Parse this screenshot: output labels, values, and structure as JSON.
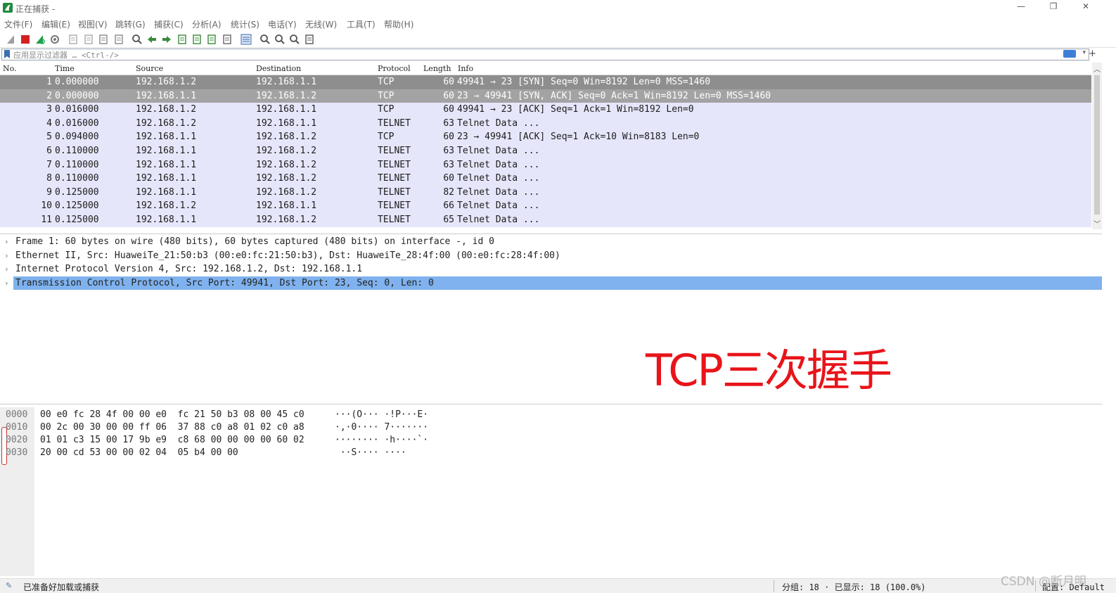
{
  "window": {
    "title": "正在捕获 -",
    "controls": {
      "minimize": "—",
      "restore": "❐",
      "close": "✕"
    }
  },
  "menu": [
    "文件(F)",
    "编辑(E)",
    "视图(V)",
    "跳转(G)",
    "捕获(C)",
    "分析(A)",
    "统计(S)",
    "电话(Y)",
    "无线(W)",
    "工具(T)",
    "帮助(H)"
  ],
  "toolbar": {
    "icons": [
      "shark-fin-start-icon",
      "stop-icon",
      "restart-icon",
      "options-gear-icon",
      "open-file-icon",
      "save-icon",
      "close-file-icon",
      "reload-icon",
      "find-icon",
      "back-arrow-icon",
      "forward-arrow-icon",
      "goto-packet-icon",
      "first-packet-icon",
      "last-packet-icon",
      "autoscroll-icon",
      "colorize-icon",
      "zoom-in-icon",
      "zoom-out-icon",
      "zoom-normal-icon",
      "resize-columns-icon"
    ]
  },
  "filter": {
    "placeholder": "应用显示过滤器 … <Ctrl-/>",
    "add_label": "+"
  },
  "packet_list": {
    "columns": [
      "No.",
      "Time",
      "Source",
      "Destination",
      "Protocol",
      "Length",
      "Info"
    ],
    "rows": [
      {
        "no": "1",
        "time": "0.000000",
        "src": "192.168.1.2",
        "dst": "192.168.1.1",
        "proto": "TCP",
        "len": "60",
        "info": "49941 → 23 [SYN] Seq=0 Win=8192 Len=0 MSS=1460",
        "bg": "#8e8e8e",
        "fg": "#ffffff"
      },
      {
        "no": "2",
        "time": "0.000000",
        "src": "192.168.1.1",
        "dst": "192.168.1.2",
        "proto": "TCP",
        "len": "60",
        "info": "23 → 49941 [SYN, ACK] Seq=0 Ack=1 Win=8192 Len=0 MSS=1460",
        "bg": "#a3a3a3",
        "fg": "#ffffff"
      },
      {
        "no": "3",
        "time": "0.016000",
        "src": "192.168.1.2",
        "dst": "192.168.1.1",
        "proto": "TCP",
        "len": "60",
        "info": "49941 → 23 [ACK] Seq=1 Ack=1 Win=8192 Len=0",
        "bg": "#e6e6fb",
        "fg": "#1c1c1c"
      },
      {
        "no": "4",
        "time": "0.016000",
        "src": "192.168.1.2",
        "dst": "192.168.1.1",
        "proto": "TELNET",
        "len": "63",
        "info": "Telnet Data ...",
        "bg": "#e6e6fb",
        "fg": "#1c1c1c"
      },
      {
        "no": "5",
        "time": "0.094000",
        "src": "192.168.1.1",
        "dst": "192.168.1.2",
        "proto": "TCP",
        "len": "60",
        "info": "23 → 49941 [ACK] Seq=1 Ack=10 Win=8183 Len=0",
        "bg": "#e6e6fb",
        "fg": "#1c1c1c"
      },
      {
        "no": "6",
        "time": "0.110000",
        "src": "192.168.1.1",
        "dst": "192.168.1.2",
        "proto": "TELNET",
        "len": "63",
        "info": "Telnet Data ...",
        "bg": "#e6e6fb",
        "fg": "#1c1c1c"
      },
      {
        "no": "7",
        "time": "0.110000",
        "src": "192.168.1.1",
        "dst": "192.168.1.2",
        "proto": "TELNET",
        "len": "63",
        "info": "Telnet Data ...",
        "bg": "#e6e6fb",
        "fg": "#1c1c1c"
      },
      {
        "no": "8",
        "time": "0.110000",
        "src": "192.168.1.1",
        "dst": "192.168.1.2",
        "proto": "TELNET",
        "len": "60",
        "info": "Telnet Data ...",
        "bg": "#e6e6fb",
        "fg": "#1c1c1c"
      },
      {
        "no": "9",
        "time": "0.125000",
        "src": "192.168.1.1",
        "dst": "192.168.1.2",
        "proto": "TELNET",
        "len": "82",
        "info": "Telnet Data ...",
        "bg": "#e6e6fb",
        "fg": "#1c1c1c"
      },
      {
        "no": "10",
        "time": "0.125000",
        "src": "192.168.1.2",
        "dst": "192.168.1.1",
        "proto": "TELNET",
        "len": "66",
        "info": "Telnet Data ...",
        "bg": "#e6e6fb",
        "fg": "#1c1c1c"
      },
      {
        "no": "11",
        "time": "0.125000",
        "src": "192.168.1.1",
        "dst": "192.168.1.2",
        "proto": "TELNET",
        "len": "65",
        "info": "Telnet Data ...",
        "bg": "#e6e6fb",
        "fg": "#1c1c1c"
      }
    ]
  },
  "details": {
    "rows": [
      {
        "text": "Frame 1: 60 bytes on wire (480 bits), 60 bytes captured (480 bits) on interface -, id 0",
        "selected": false
      },
      {
        "text": "Ethernet II, Src: HuaweiTe_21:50:b3 (00:e0:fc:21:50:b3), Dst: HuaweiTe_28:4f:00 (00:e0:fc:28:4f:00)",
        "selected": false
      },
      {
        "text": "Internet Protocol Version 4, Src: 192.168.1.2, Dst: 192.168.1.1",
        "selected": false
      },
      {
        "text": "Transmission Control Protocol, Src Port: 49941, Dst Port: 23, Seq: 0, Len: 0",
        "selected": true
      }
    ],
    "expand_glyph": "›"
  },
  "annotation": {
    "text": "TCP三次握手",
    "color": "#e8141a"
  },
  "bytes": {
    "rows": [
      {
        "offset": "0000",
        "hex": "00 e0 fc 28 4f 00 00 e0  fc 21 50 b3 08 00 45 c0",
        "ascii": "···(O··· ·!P···E·"
      },
      {
        "offset": "0010",
        "hex": "00 2c 00 30 00 00 ff 06  37 88 c0 a8 01 02 c0 a8",
        "ascii": "·,·0···· 7·······"
      },
      {
        "offset": "0020",
        "hex": "01 01 c3 15 00 17 9b e9  c8 68 00 00 00 00 60 02",
        "ascii": "········ ·h····`·"
      },
      {
        "offset": "0030",
        "hex": "20 00 cd 53 00 00 02 04  05 b4 00 00",
        "ascii": " ··S···· ····"
      }
    ]
  },
  "status": {
    "ready": "已准备好加载或捕获",
    "stats": "分组: 18 · 已显示: 18 (100.0%)",
    "profile": "配置: Default",
    "watermark": "CSDN @断月明"
  },
  "colors": {
    "selected_detail": "#7fb2ee",
    "accent_blue": "#3d7fd6"
  }
}
